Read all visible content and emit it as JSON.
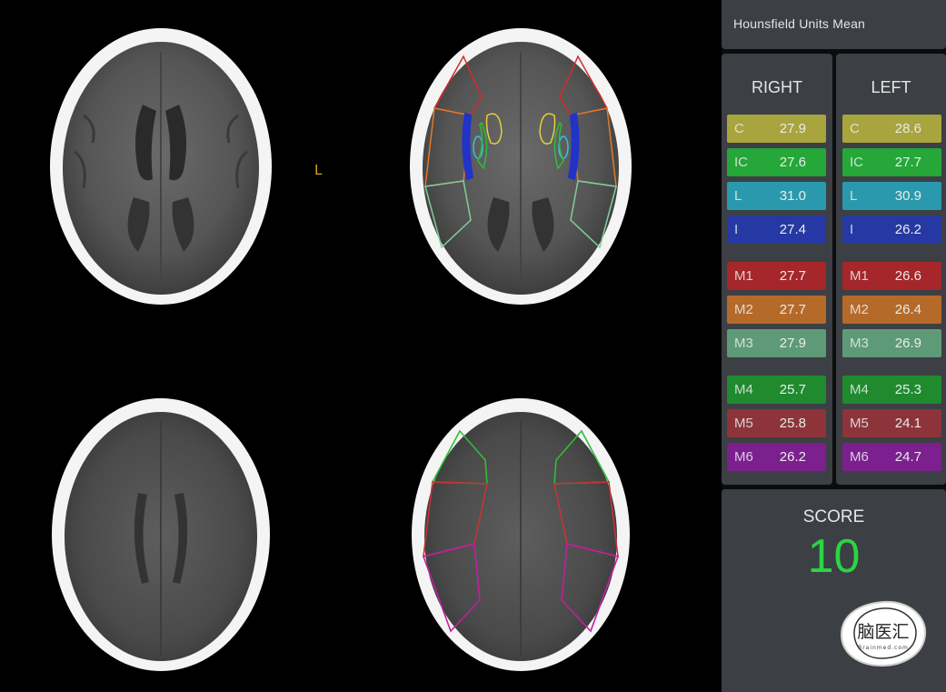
{
  "viewer": {
    "orientation_left_label": "L"
  },
  "panel": {
    "title": "Hounsfield Units Mean",
    "right_header": "RIGHT",
    "left_header": "LEFT",
    "rows": [
      {
        "label": "C",
        "right": "27.9",
        "left": "28.6",
        "color": "#a8a43e"
      },
      {
        "label": "IC",
        "right": "27.6",
        "left": "27.7",
        "color": "#25a73a"
      },
      {
        "label": "L",
        "right": "31.0",
        "left": "30.9",
        "color": "#2b99ad"
      },
      {
        "label": "I",
        "right": "27.4",
        "left": "26.2",
        "color": "#2538a3"
      },
      {
        "label": "M1",
        "right": "27.7",
        "left": "26.6",
        "color": "#a5262b"
      },
      {
        "label": "M2",
        "right": "27.7",
        "left": "26.4",
        "color": "#b56a2a"
      },
      {
        "label": "M3",
        "right": "27.9",
        "left": "26.9",
        "color": "#5e9a78"
      },
      {
        "label": "M4",
        "right": "25.7",
        "left": "25.3",
        "color": "#1f8a2e"
      },
      {
        "label": "M5",
        "right": "25.8",
        "left": "24.1",
        "color": "#8c343a"
      },
      {
        "label": "M6",
        "right": "26.2",
        "left": "24.7",
        "color": "#7c1f8f"
      }
    ],
    "score_label": "SCORE",
    "score_value": "10",
    "logo_text": "脑医汇",
    "logo_subtext": "Brainmed.com"
  }
}
